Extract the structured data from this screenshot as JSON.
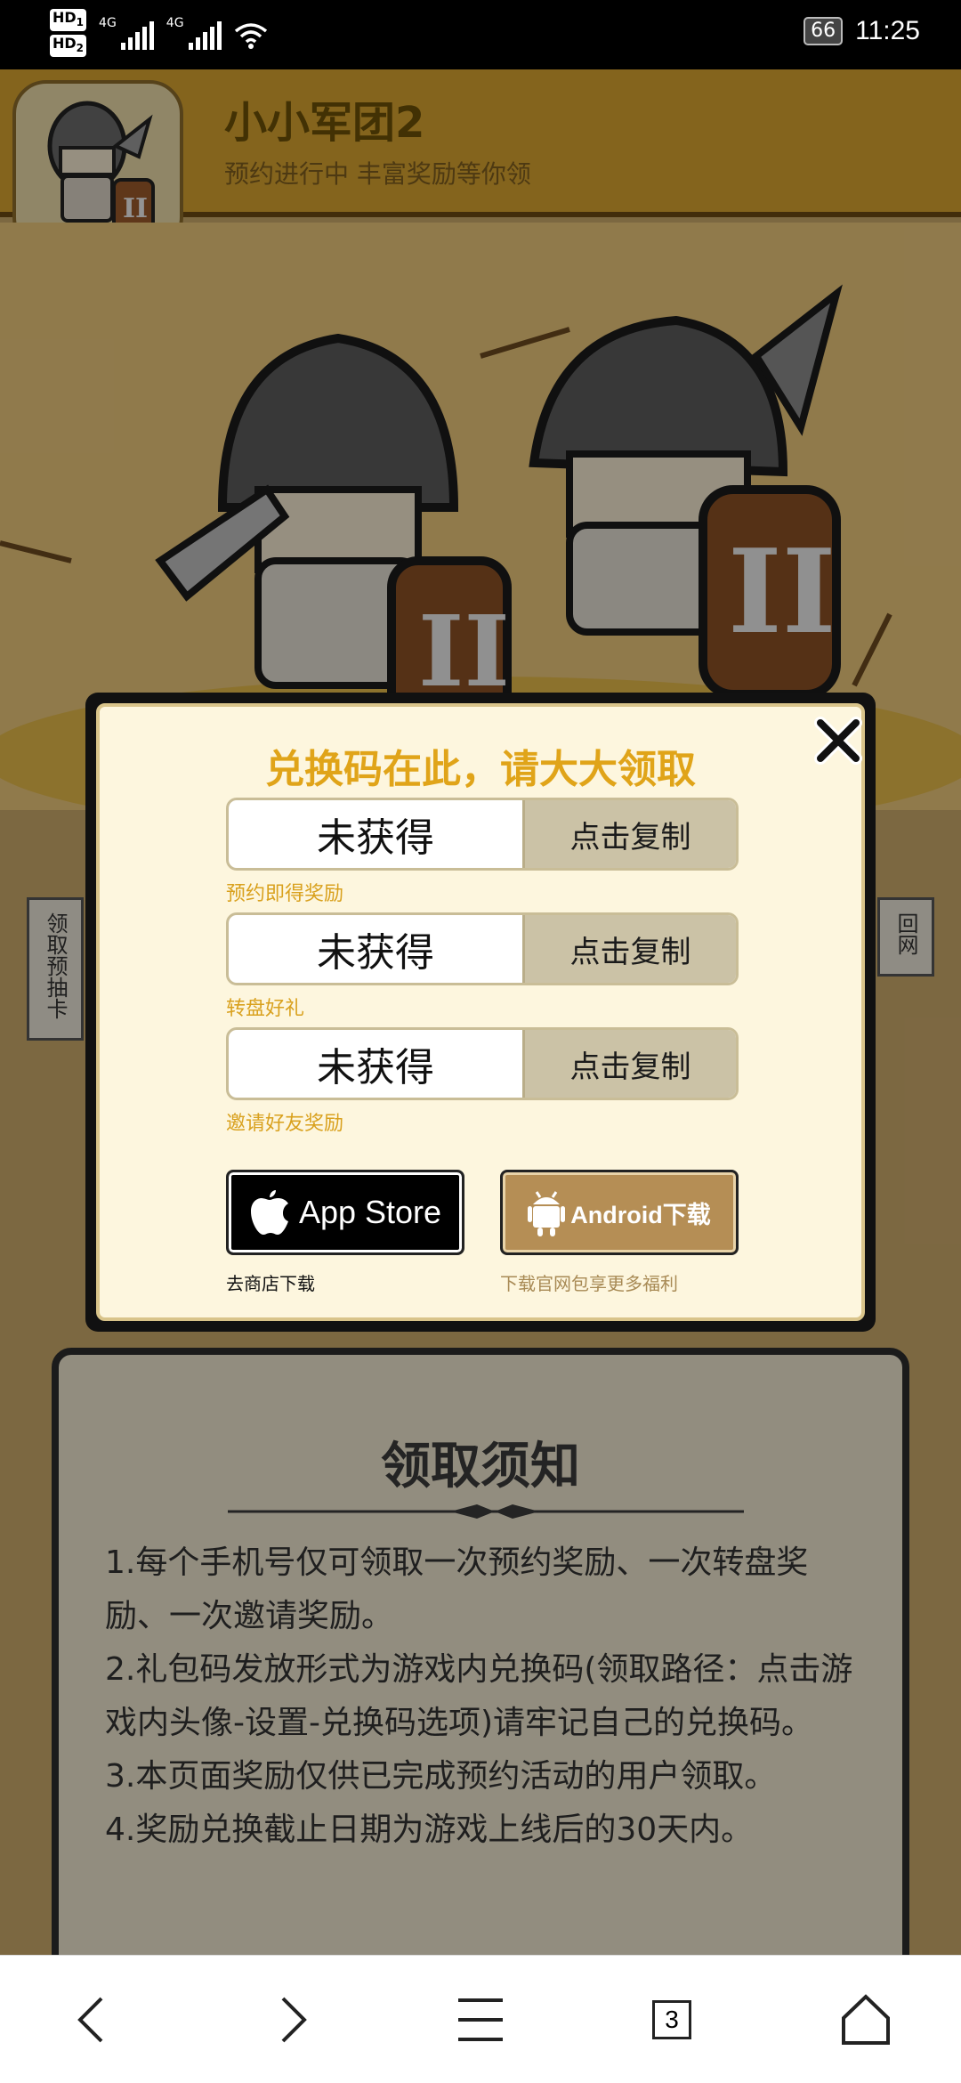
{
  "status_bar": {
    "hd1": "HD",
    "hd1_sub": "1",
    "hd2": "HD",
    "hd2_sub": "2",
    "sig1_label": "4G",
    "sig2_label": "4G",
    "battery": "66",
    "time": "11:25"
  },
  "game": {
    "title": "小小军团2",
    "subtitle": "预约进行中  丰富奖励等你领"
  },
  "side_tabs": {
    "left": "领取预抽卡",
    "right": "回网"
  },
  "modal": {
    "title": "兑换码在此，请大大领取",
    "codes": [
      {
        "value": "未获得",
        "copy_label": "点击复制",
        "caption": "预约即得奖励"
      },
      {
        "value": "未获得",
        "copy_label": "点击复制",
        "caption": "转盘好礼"
      },
      {
        "value": "未获得",
        "copy_label": "点击复制",
        "caption": "邀请好友奖励"
      }
    ],
    "appstore_label": "App Store",
    "appstore_caption": "去商店下载",
    "android_label": "Android下载",
    "android_caption": "下载官网包享更多福利"
  },
  "notice": {
    "title": "领取须知",
    "items": [
      "1.每个手机号仅可领取一次预约奖励、一次转盘奖励、一次邀请奖励。",
      "2.礼包码发放形式为游戏内兑换码(领取路径：点击游戏内头像-设置-兑换码选项)请牢记自己的兑换码。",
      "3.本页面奖励仅供已完成预约活动的用户领取。",
      "4.奖励兑换截止日期为游戏上线后的30天内。"
    ]
  },
  "nav": {
    "tab_count": "3",
    "icons": [
      "back-icon",
      "forward-icon",
      "menu-icon",
      "tabs-icon",
      "home-icon"
    ]
  },
  "colors": {
    "modal_title": "#e0a419",
    "caption": "#d9a11e",
    "android_button": "#b58e55"
  }
}
